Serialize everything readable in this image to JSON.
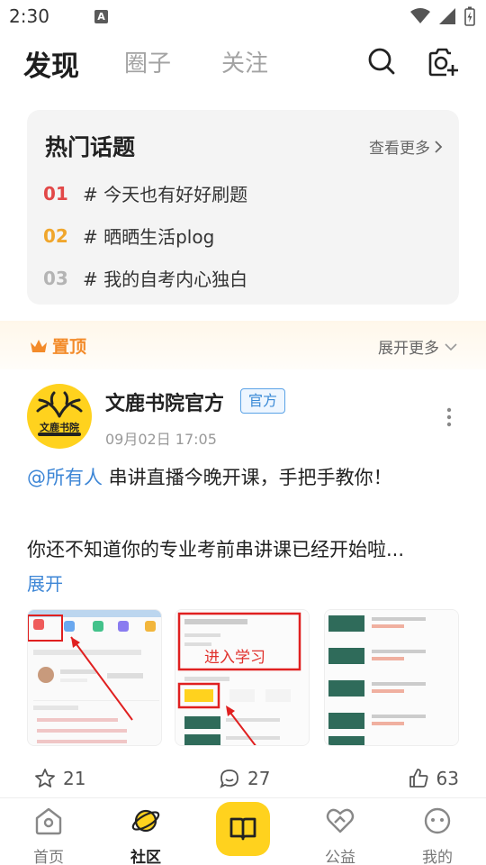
{
  "status_bar": {
    "time": "2:30",
    "notification_letter": "A"
  },
  "header": {
    "tabs": [
      {
        "label": "发现",
        "active": true
      },
      {
        "label": "圈子",
        "active": false
      },
      {
        "label": "关注",
        "active": false
      }
    ],
    "icons": [
      "search-icon",
      "camera-plus-icon"
    ]
  },
  "hot_topics": {
    "title": "热门话题",
    "more_label": "查看更多",
    "items": [
      {
        "rank": "01",
        "text": "# 今天也有好好刷题"
      },
      {
        "rank": "02",
        "text": "# 晒晒生活plog"
      },
      {
        "rank": "03",
        "text": "# 我的自考内心独白"
      }
    ]
  },
  "pinned": {
    "label": "置顶",
    "expand_label": "展开更多"
  },
  "post": {
    "avatar_text": "文鹿书院",
    "author": "文鹿书院官方",
    "badge": "官方",
    "time": "09月02日 17:05",
    "mention": "@所有人",
    "line1_rest": " 串讲直播今晚开课，手把手教你！",
    "line2": "你还不知道你的专业考前串讲课已经开始啦...",
    "expand_label": "展开",
    "image2_overlay": "进入学习",
    "stats": {
      "stars": "21",
      "comments": "27",
      "likes": "63"
    }
  },
  "bottom_nav": {
    "items": [
      {
        "label": "首页",
        "icon": "home-icon",
        "active": false
      },
      {
        "label": "社区",
        "icon": "planet-icon",
        "active": true
      },
      {
        "label": "",
        "icon": "book-icon",
        "active": false
      },
      {
        "label": "公益",
        "icon": "heart-icon",
        "active": false
      },
      {
        "label": "我的",
        "icon": "face-icon",
        "active": false
      }
    ]
  },
  "colors": {
    "brand_yellow": "#ffd21e",
    "rank1": "#e24848",
    "rank2": "#f0a62c",
    "rank3": "#b4b4b4",
    "link_blue": "#3d86d6",
    "pinned_orange": "#f38b2a"
  }
}
